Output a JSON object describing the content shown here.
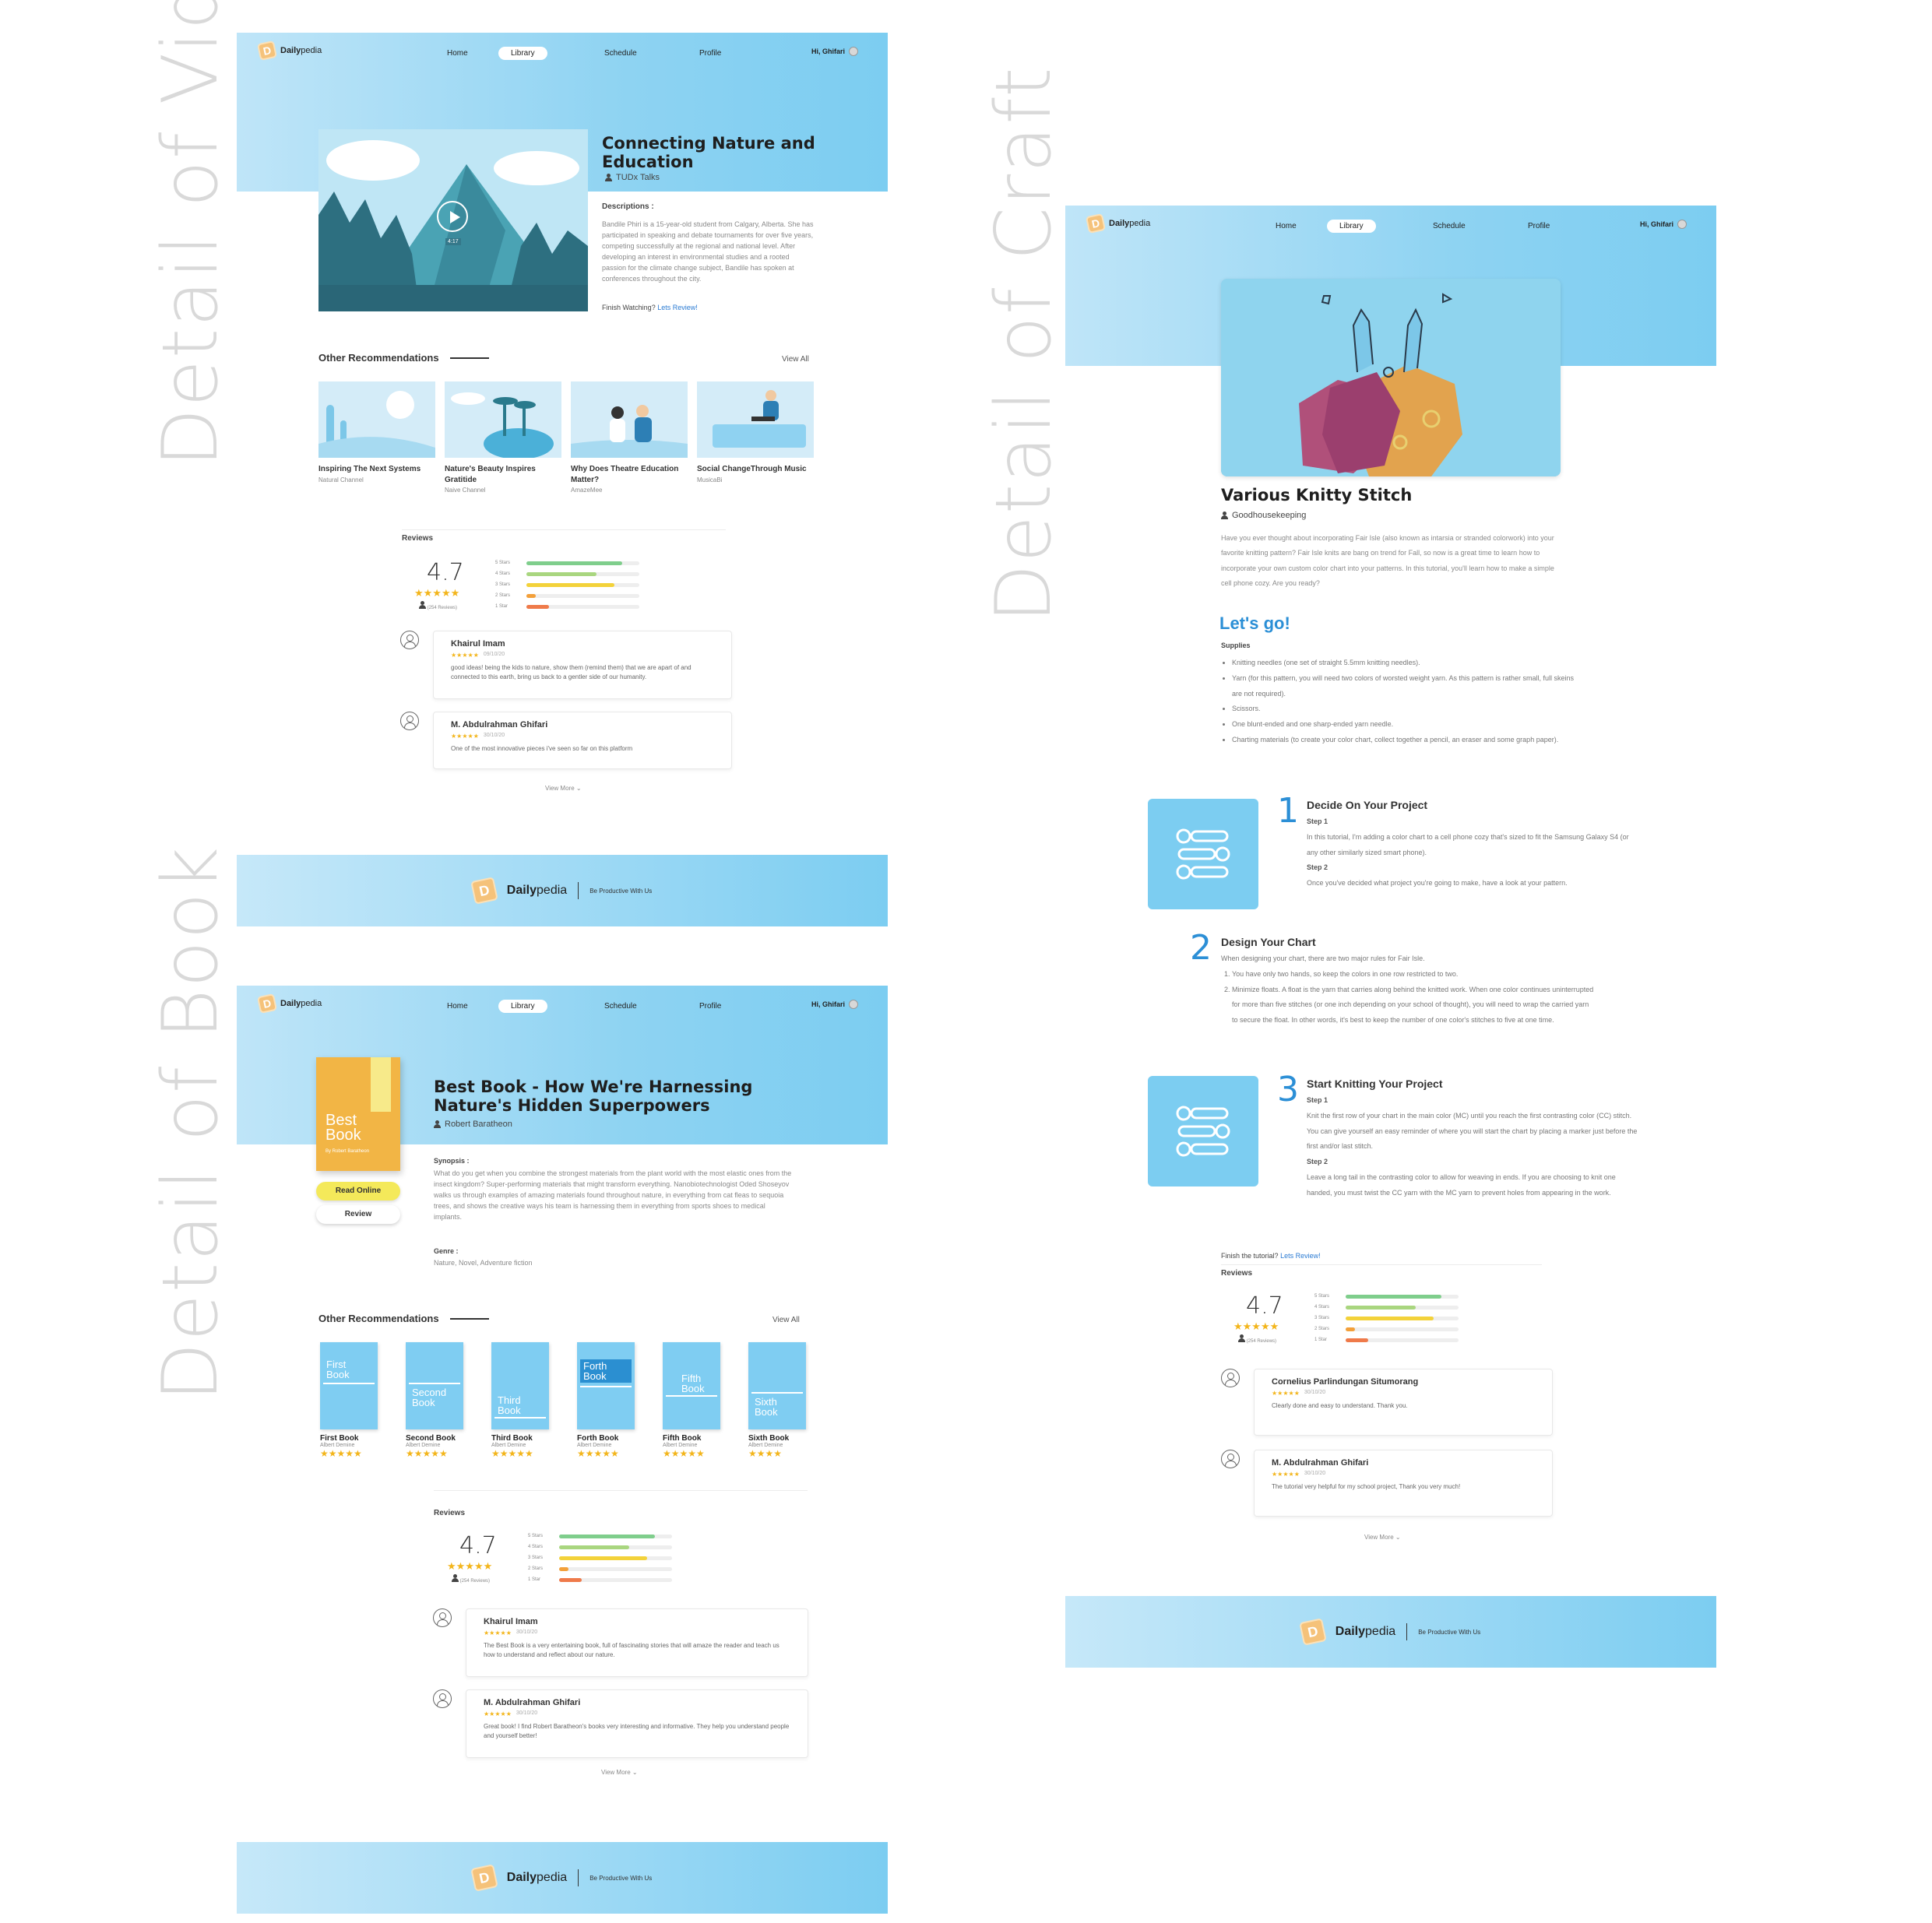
{
  "labels": {
    "video": "Detail of Video",
    "craft": "Detail of Craft",
    "book": "Detail of Book"
  },
  "nav": {
    "brand_prefix": "Daily",
    "brand_suffix": "pedia",
    "items": [
      "Home",
      "Library",
      "Schedule",
      "Profile"
    ],
    "active": "Library",
    "user": "Hi, Ghifari"
  },
  "footer": {
    "brand_prefix": "Daily",
    "brand_suffix": "pedia",
    "tagline": "Be Productive With Us"
  },
  "video": {
    "title": "Connecting Nature and Education",
    "author": "TUDx Talks",
    "duration": "4:17",
    "desc_label": "Descriptions :",
    "description": "Bandile Phiri is a 15-year-old student from Calgary, Alberta. She has participated in speaking and debate tournaments for over five years, competing successfully at the regional and national level. After developing an interest in environmental studies and a rooted passion for the climate change subject, Bandile has spoken at conferences throughout the city.",
    "finish_prompt": "Finish Watching?",
    "finish_link": "Lets Review!",
    "recs_title": "Other Recommendations",
    "view_all": "View All",
    "recs": [
      {
        "title": "Inspiring The Next Systems",
        "channel": "Natural Channel"
      },
      {
        "title": "Nature's Beauty Inspires Gratitide",
        "channel": "Naive Channel"
      },
      {
        "title": "Why Does Theatre Education Matter?",
        "channel": "AmazeMee"
      },
      {
        "title": "Social ChangeThrough Music",
        "channel": "MusicaBi"
      }
    ],
    "reviews_title": "Reviews",
    "rating": "4.7",
    "rating_count": "(254 Reviews)",
    "bars": [
      {
        "label": "5 Stars",
        "value": 0.85,
        "color": "#7fce8c"
      },
      {
        "label": "4 Stars",
        "value": 0.62,
        "color": "#a9d67f"
      },
      {
        "label": "3 Stars",
        "value": 0.78,
        "color": "#f3d23a"
      },
      {
        "label": "2 Stars",
        "value": 0.08,
        "color": "#f3a03a"
      },
      {
        "label": "1 Star",
        "value": 0.2,
        "color": "#ef7a4a"
      }
    ],
    "reviews": [
      {
        "name": "Khairul Imam",
        "date": "09/10/20",
        "text": "good ideas! being the kids to nature, show them (remind them) that we are apart of and connected to this earth, bring us back to a gentler side of our humanity."
      },
      {
        "name": "M. Abdulrahman Ghifari",
        "date": "30/10/20",
        "text": "One of the most innovative pieces i've seen so far on this platform"
      }
    ],
    "view_more": "View More"
  },
  "book": {
    "title": "Best Book - How We're Harnessing Nature's Hidden Superpowers",
    "author": "Robert Baratheon",
    "cover_title": "Best Book",
    "cover_author": "By Robert Baratheon",
    "read_online": "Read Online",
    "review": "Review",
    "synopsis_label": "Synopsis :",
    "synopsis": "What do you get when you combine the strongest materials from the plant world with the most elastic ones from the insect kingdom? Super-performing materials that might transform everything. Nanobiotechnologist Oded Shoseyov walks us through examples of amazing materials found throughout nature, in everything from cat fleas to sequoia trees, and shows the creative ways his team is harnessing them in everything from sports shoes to medical implants.",
    "genre_label": "Genre :",
    "genre": "Nature, Novel, Adventure fiction",
    "recs_title": "Other Recommendations",
    "view_all": "View All",
    "recs": [
      {
        "title": "First Book",
        "author": "Albert Demine",
        "cover": "First Book",
        "stars": "★★★★★"
      },
      {
        "title": "Second Book",
        "author": "Albert Demine",
        "cover": "Second Book",
        "stars": "★★★★★"
      },
      {
        "title": "Third Book",
        "author": "Albert Demine",
        "cover": "Third Book",
        "stars": "★★★★★"
      },
      {
        "title": "Forth Book",
        "author": "Albert Demine",
        "cover": "Forth Book",
        "stars": "★★★★★"
      },
      {
        "title": "Fifth Book",
        "author": "Albert Demine",
        "cover": "Fifth Book",
        "stars": "★★★★★"
      },
      {
        "title": "Sixth Book",
        "author": "Albert Demine",
        "cover": "Sixth Book",
        "stars": "★★★★"
      }
    ],
    "reviews_title": "Reviews",
    "rating": "4.7",
    "rating_count": "(254 Reviews)",
    "bars": [
      {
        "label": "5 Stars",
        "value": 0.85,
        "color": "#7fce8c"
      },
      {
        "label": "4 Stars",
        "value": 0.62,
        "color": "#a9d67f"
      },
      {
        "label": "3 Stars",
        "value": 0.78,
        "color": "#f3d23a"
      },
      {
        "label": "2 Stars",
        "value": 0.08,
        "color": "#f3a03a"
      },
      {
        "label": "1 Star",
        "value": 0.2,
        "color": "#ef7a4a"
      }
    ],
    "reviews": [
      {
        "name": "Khairul Imam",
        "date": "30/10/20",
        "text": "The Best Book is a very entertaining book, full of fascinating stories that will amaze the reader and teach us how to understand and reflect about our nature."
      },
      {
        "name": "M. Abdulrahman Ghifari",
        "date": "30/10/20",
        "text": "Great book! I find Robert Baratheon's books very interesting and informative. They help you understand people and yourself better!"
      }
    ],
    "view_more": "View More"
  },
  "craft": {
    "title": "Various Knitty Stitch",
    "author": "Goodhousekeeping",
    "intro": "Have you ever thought about incorporating Fair Isle (also known as intarsia or stranded colorwork) into your favorite knitting pattern? Fair Isle knits are bang on trend for Fall, so now is a great time to learn how to incorporate your own custom color chart into your patterns. In this tutorial, you'll learn how to make a simple cell phone cozy. Are you ready?",
    "lets_go": "Let's go!",
    "supplies_label": "Supplies",
    "supplies": [
      "Knitting needles (one set of straight 5.5mm knitting needles).",
      "Yarn (for this pattern, you will need two colors of worsted weight yarn. As this pattern is rather small, full skeins are not required).",
      "Scissors.",
      "One blunt-ended and one sharp-ended yarn needle.",
      "Charting materials (to create your color chart, collect together a pencil, an eraser and some graph paper)."
    ],
    "steps": [
      {
        "num": "1",
        "title": "Decide On Your Project",
        "s1_label": "Step 1",
        "s1": "In this tutorial, I'm adding a color chart to a cell phone cozy that's sized to fit the Samsung Galaxy S4 (or any other similarly sized smart phone).",
        "s2_label": "Step 2",
        "s2": "Once you've decided what project you're going to make, have a look at your pattern."
      },
      {
        "num": "2",
        "title": "Design Your Chart",
        "intro": "When designing your chart, there are two major rules for Fair Isle.",
        "r1": "You have only two hands, so keep the colors in one row restricted to two.",
        "r2": "Minimize floats. A float is the yarn that carries along behind the knitted work. When one color continues uninterrupted for more than five stitches (or one inch depending on your school of thought), you will need to wrap the carried yarn to secure the float. In other words, it's best to keep the number of one color's stitches to five at one time."
      },
      {
        "num": "3",
        "title": "Start Knitting Your Project",
        "s1_label": "Step 1",
        "s1": "Knit the first row of your chart in the main color (MC) until you reach the first contrasting color (CC) stitch. You can give yourself an easy reminder of where you will start the chart by placing a marker just before the first and/or last stitch.",
        "s2_label": "Step 2",
        "s2": "Leave a long tail in the contrasting color to allow for weaving in ends. If you are choosing to knit one handed, you must twist the CC yarn with the MC yarn to prevent holes from appearing in the work."
      }
    ],
    "finish_prompt": "Finish the tutorial?",
    "finish_link": "Lets Review!",
    "reviews_title": "Reviews",
    "rating": "4.7",
    "rating_count": "(254 Reviews)",
    "bars": [
      {
        "label": "5 Stars",
        "value": 0.85,
        "color": "#7fce8c"
      },
      {
        "label": "4 Stars",
        "value": 0.62,
        "color": "#a9d67f"
      },
      {
        "label": "3 Stars",
        "value": 0.78,
        "color": "#f3d23a"
      },
      {
        "label": "2 Stars",
        "value": 0.08,
        "color": "#f3a03a"
      },
      {
        "label": "1 Star",
        "value": 0.2,
        "color": "#ef7a4a"
      }
    ],
    "reviews": [
      {
        "name": "Cornelius Parlindungan Situmorang",
        "date": "30/10/20",
        "text": "Clearly done and easy to understand. Thank you."
      },
      {
        "name": "M. Abdulrahman Ghifari",
        "date": "30/10/20",
        "text": "The tutorial very helpful for my school project, Thank you very much!"
      }
    ],
    "view_more": "View More"
  }
}
